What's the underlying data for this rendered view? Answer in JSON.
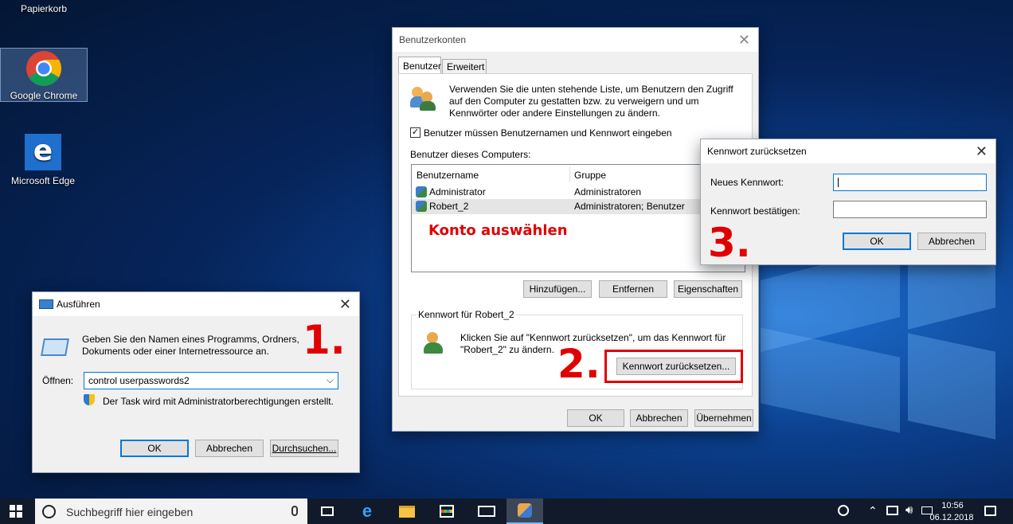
{
  "desktop": {
    "recycle_bin": "Papierkorb",
    "icons": [
      {
        "label": "Google Chrome"
      },
      {
        "label": "Microsoft Edge"
      }
    ]
  },
  "run_dialog": {
    "title": "Ausführen",
    "description": "Geben Sie den Namen eines Programms, Ordners, Dokuments oder einer Internetressource an.",
    "open_label": "Öffnen:",
    "open_value": "control userpasswords2",
    "admin_note": "Der Task wird mit Administratorberechtigungen erstellt.",
    "ok": "OK",
    "cancel": "Abbrechen",
    "browse": "Durchsuchen..."
  },
  "user_accounts": {
    "title": "Benutzerkonten",
    "tabs": [
      "Benutzer",
      "Erweitert"
    ],
    "intro": "Verwenden Sie die unten stehende Liste, um Benutzern den Zugriff auf den Computer zu gestatten bzw. zu verweigern und um Kennwörter oder andere Einstellungen zu ändern.",
    "require_checkbox": "Benutzer müssen Benutzernamen und Kennwort eingeben",
    "require_checked": true,
    "users_heading": "Benutzer dieses Computers:",
    "columns": [
      "Benutzername",
      "Gruppe"
    ],
    "rows": [
      {
        "name": "Administrator",
        "group": "Administratoren"
      },
      {
        "name": "Robert_2",
        "group": "Administratoren; Benutzer"
      }
    ],
    "annotation": "Konto auswählen",
    "add": "Hinzufügen...",
    "remove": "Entfernen",
    "properties": "Eigenschaften",
    "password_group": "Kennwort für Robert_2",
    "password_text": "Klicken Sie auf \"Kennwort zurücksetzen\", um das Kennwort für \"Robert_2\" zu ändern.",
    "reset_button": "Kennwort zurücksetzen...",
    "ok": "OK",
    "cancel": "Abbrechen",
    "apply": "Übernehmen"
  },
  "reset_dialog": {
    "title": "Kennwort zurücksetzen",
    "new_password_label": "Neues Kennwort:",
    "confirm_label": "Kennwort bestätigen:",
    "ok": "OK",
    "cancel": "Abbrechen"
  },
  "steps": [
    "1.",
    "2.",
    "3."
  ],
  "taskbar": {
    "search_placeholder": "Suchbegriff hier eingeben",
    "time": "10:56",
    "date": "06.12.2018"
  },
  "colors": {
    "accent": "#0078d7",
    "annotation_red": "#e00000",
    "taskbar": "#101a2a"
  }
}
